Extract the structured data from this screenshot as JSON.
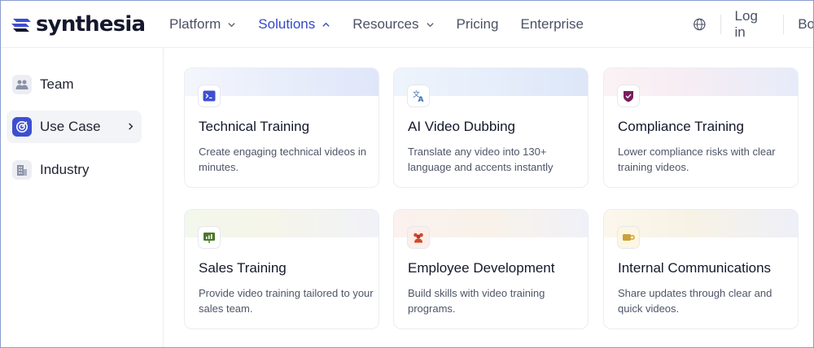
{
  "header": {
    "logo_text": "synthesia",
    "nav": [
      {
        "label": "Platform",
        "has_chevron": true,
        "active": false
      },
      {
        "label": "Solutions",
        "has_chevron": true,
        "active": true
      },
      {
        "label": "Resources",
        "has_chevron": true,
        "active": false
      },
      {
        "label": "Pricing",
        "has_chevron": false,
        "active": false
      },
      {
        "label": "Enterprise",
        "has_chevron": false,
        "active": false
      }
    ],
    "login_label": "Log in",
    "book_label_visible": "Bo"
  },
  "sidebar": {
    "items": [
      {
        "label": "Team",
        "icon": "users-icon",
        "active": false
      },
      {
        "label": "Use Case",
        "icon": "target-icon",
        "active": true
      },
      {
        "label": "Industry",
        "icon": "building-icon",
        "active": false
      }
    ]
  },
  "cards": [
    {
      "title": "Technical Training",
      "desc": "Create engaging technical videos in minutes.",
      "icon": "terminal-icon",
      "accent": "#3d4fd0"
    },
    {
      "title": "AI Video Dubbing",
      "desc": "Translate any video into 130+ language and accents instantly",
      "icon": "translate-icon",
      "accent": "#3a6fb7"
    },
    {
      "title": "Compliance Training",
      "desc": "Lower compliance risks with clear training videos.",
      "icon": "shield-icon",
      "accent": "#7a1f5c"
    },
    {
      "title": "Sales Training",
      "desc": "Provide video training tailored to your sales team.",
      "icon": "presentation-icon",
      "accent": "#4a7a2a"
    },
    {
      "title": "Employee Development",
      "desc": "Build skills with video training programs.",
      "icon": "people-icon",
      "accent": "#d04a2a"
    },
    {
      "title": "Internal Communications",
      "desc": "Share updates through clear and quick videos.",
      "icon": "megaphone-icon",
      "accent": "#c9a23a"
    }
  ],
  "colors": {
    "brand": "#3d4fd0",
    "active_nav": "#3547c6",
    "text": "#1f2330",
    "muted": "#4e5568"
  }
}
